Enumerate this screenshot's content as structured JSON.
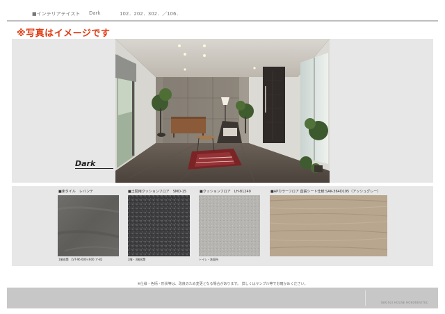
{
  "header": {
    "section": "■インテリアテイスト",
    "style_name": "Dark",
    "plan_codes": "102．202．302．／106．"
  },
  "notice": "※写真はイメージです",
  "photo_label": "Dark",
  "materials": [
    {
      "title": "■床タイル　レバンテ",
      "note": "1階玄関　LVT-96 600×600 ア-82"
    },
    {
      "title": "■土間用クッションフロア　SMD-15",
      "note": "2階・3階玄関"
    },
    {
      "title": "■クッションフロア　LH-81249",
      "note": "トイレ・洗面所"
    },
    {
      "title": "■APカラーフロア 直張シート仕様 SAK-364D195（アッシュグレー）",
      "note": ""
    }
  ],
  "disclaimer": "※仕様・色柄・形状等は、改良のため変更となる場合があります。 詳しくはサンプル等でお確かめください。",
  "footer_text": "SEKISUI HOUSE HOKOREVITEC",
  "colors": {
    "notice": "#e03a12",
    "panel": "#e7e7e8",
    "footer": "#c7c7c8"
  }
}
